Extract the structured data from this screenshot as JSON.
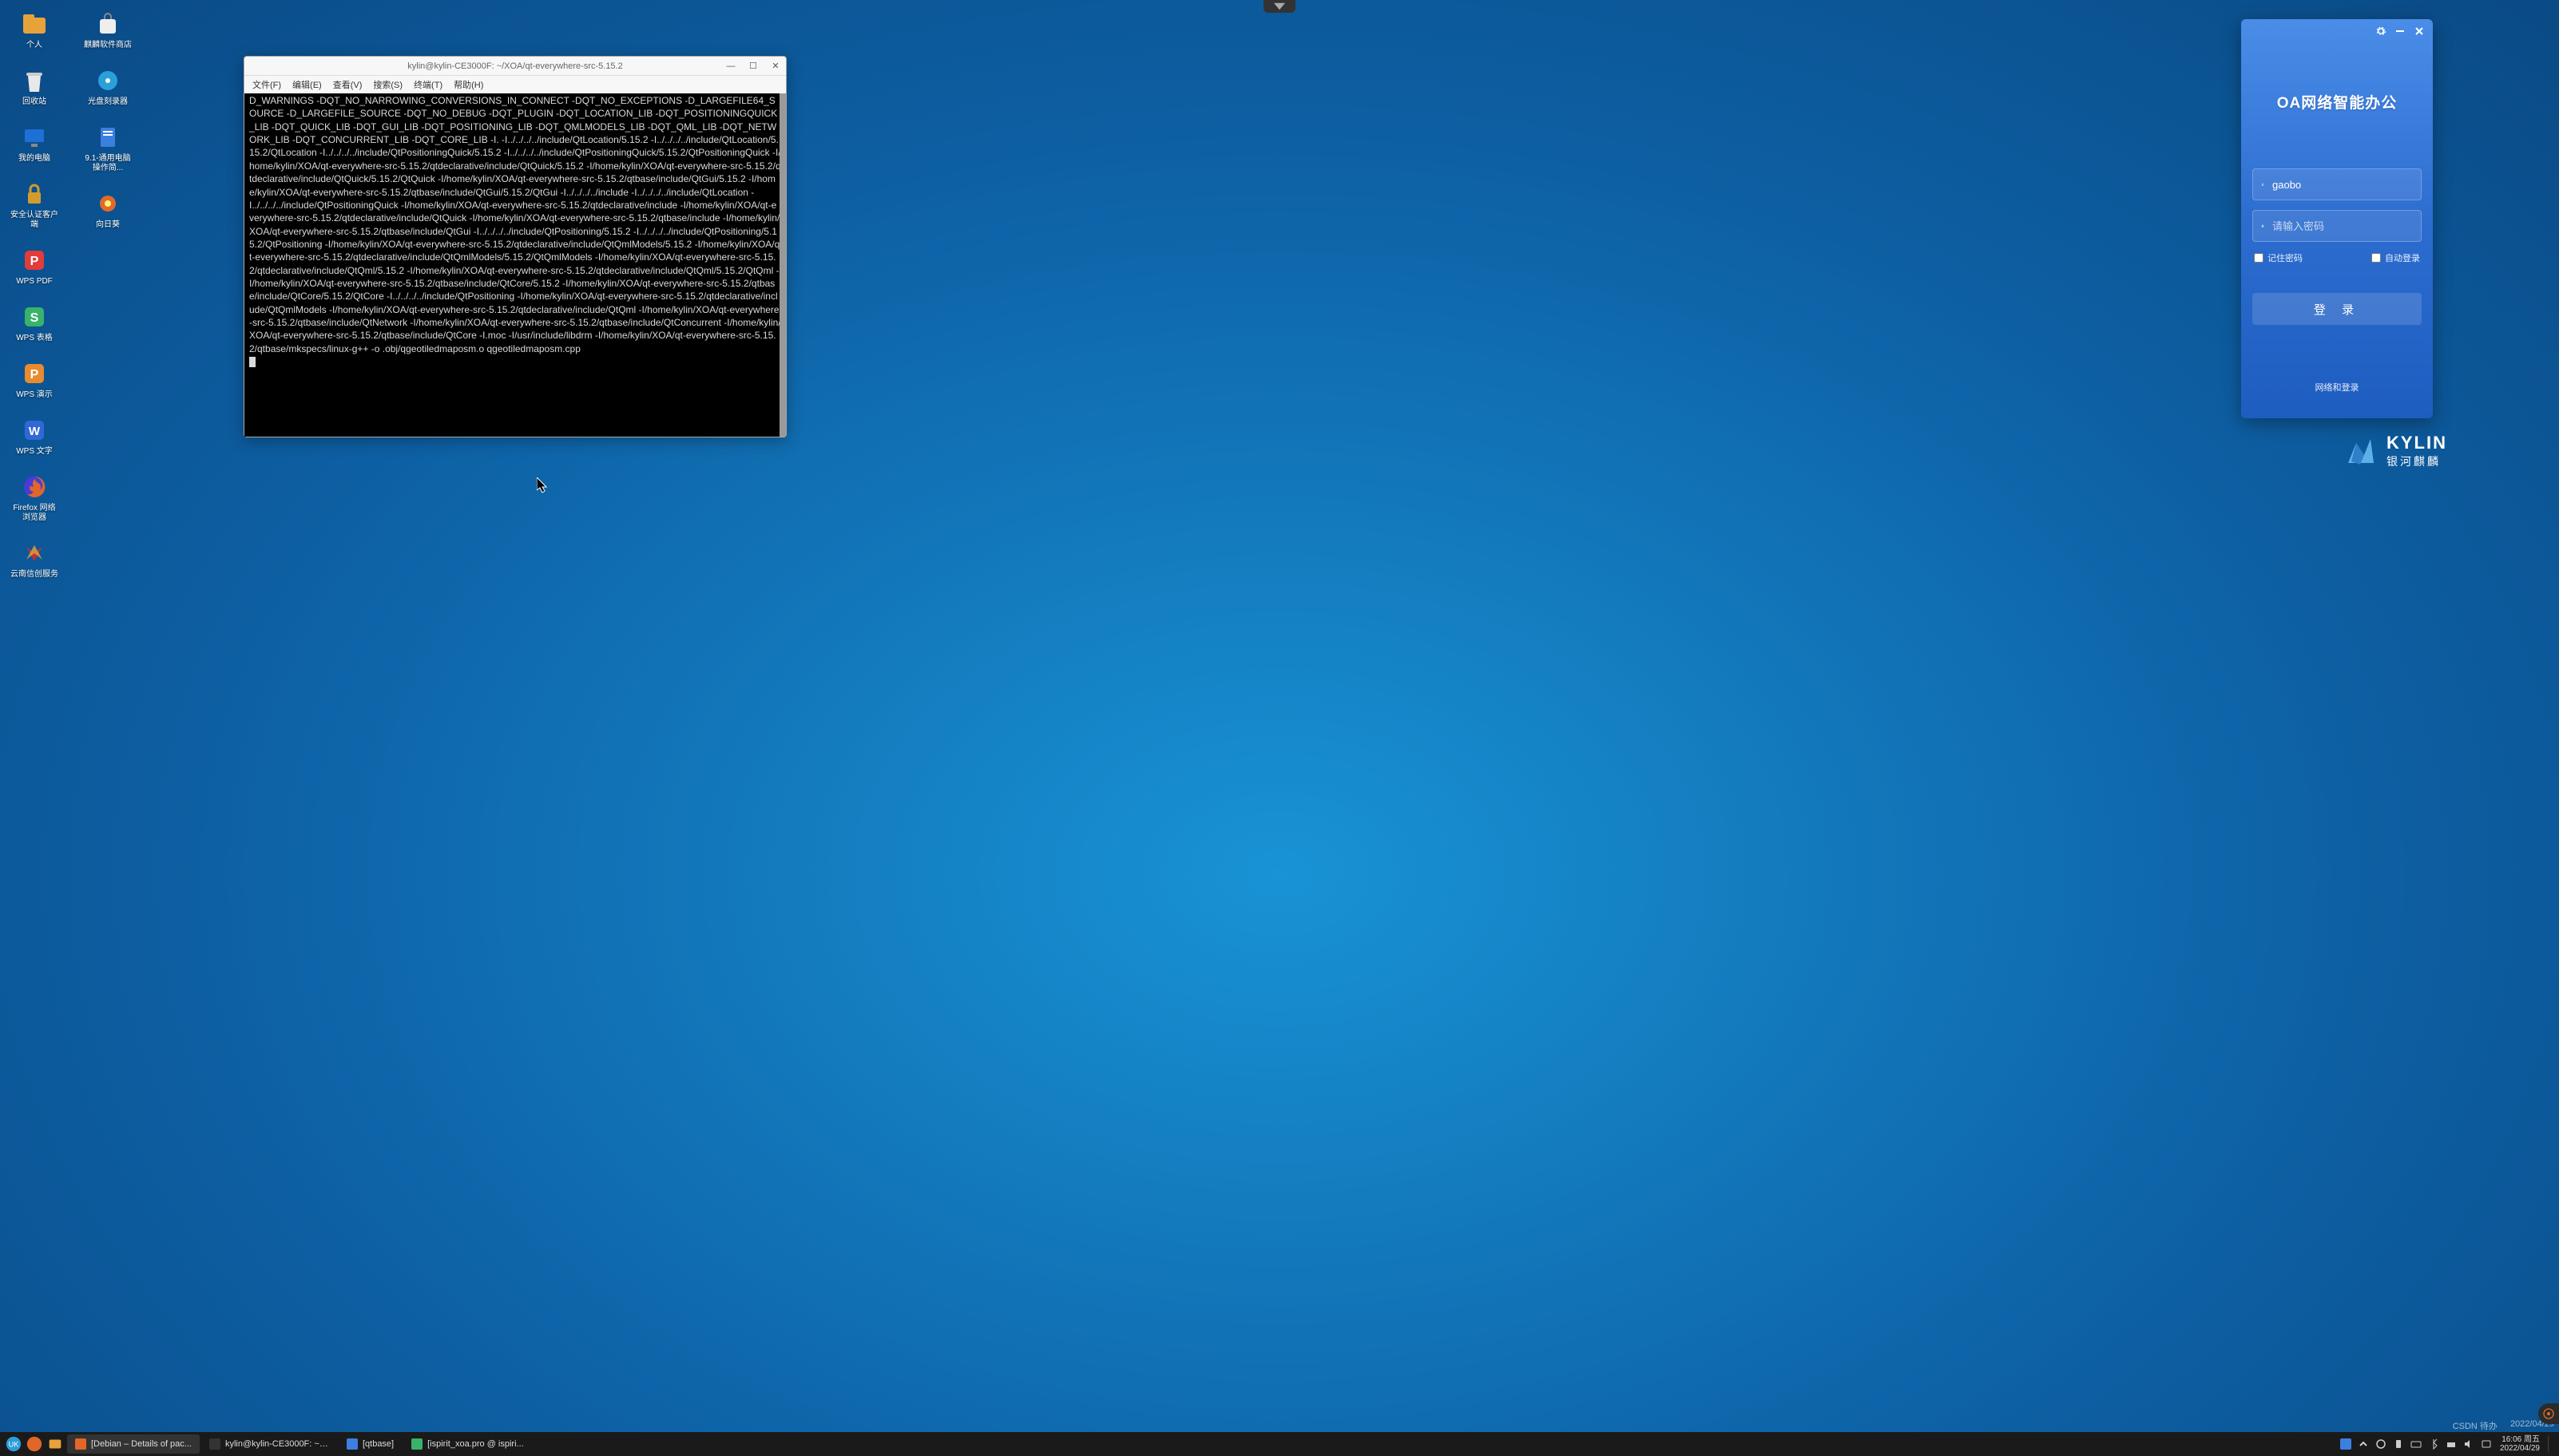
{
  "desktop": {
    "col1": [
      {
        "label": "个人",
        "color": "#e8a23a",
        "icon": "folder"
      },
      {
        "label": "回收站",
        "color": "#e8e8e8",
        "icon": "trash"
      },
      {
        "label": "我的电脑",
        "color": "#1e6fd6",
        "icon": "monitor"
      },
      {
        "label": "安全认证客户端",
        "color": "#d19b2e",
        "icon": "lock"
      },
      {
        "label": "WPS PDF",
        "color": "#e23b3b",
        "icon": "p"
      },
      {
        "label": "WPS 表格",
        "color": "#39b26a",
        "icon": "s"
      },
      {
        "label": "WPS 演示",
        "color": "#e88a2e",
        "icon": "p"
      },
      {
        "label": "WPS 文字",
        "color": "#3068d6",
        "icon": "w"
      },
      {
        "label": "Firefox 网络浏览器",
        "color": "#e0662a",
        "icon": "fire"
      },
      {
        "label": "云南信创服务",
        "color": "#c43030",
        "icon": "x"
      }
    ],
    "col2": [
      {
        "label": "麒麟软件商店",
        "color": "#eee",
        "icon": "bag"
      },
      {
        "label": "光盘刻录器",
        "color": "#2aa0d8",
        "icon": "disc"
      },
      {
        "label": "9.1-通用电脑操作简...",
        "color": "#3b7fe0",
        "icon": "doc"
      },
      {
        "label": "向日葵",
        "color": "#e06a2a",
        "icon": "sun"
      }
    ]
  },
  "terminal": {
    "title": "kylin@kylin-CE3000F: ~/XOA/qt-everywhere-src-5.15.2",
    "menu": [
      "文件(F)",
      "编辑(E)",
      "查看(V)",
      "搜索(S)",
      "终端(T)",
      "帮助(H)"
    ],
    "content": "D_WARNINGS -DQT_NO_NARROWING_CONVERSIONS_IN_CONNECT -DQT_NO_EXCEPTIONS -D_LARGEFILE64_SOURCE -D_LARGEFILE_SOURCE -DQT_NO_DEBUG -DQT_PLUGIN -DQT_LOCATION_LIB -DQT_POSITIONINGQUICK_LIB -DQT_QUICK_LIB -DQT_GUI_LIB -DQT_POSITIONING_LIB -DQT_QMLMODELS_LIB -DQT_QML_LIB -DQT_NETWORK_LIB -DQT_CONCURRENT_LIB -DQT_CORE_LIB -I. -I../../../../include/QtLocation/5.15.2 -I../../../../include/QtLocation/5.15.2/QtLocation -I../../../../include/QtPositioningQuick/5.15.2 -I../../../../include/QtPositioningQuick/5.15.2/QtPositioningQuick -I/home/kylin/XOA/qt-everywhere-src-5.15.2/qtdeclarative/include/QtQuick/5.15.2 -I/home/kylin/XOA/qt-everywhere-src-5.15.2/qtdeclarative/include/QtQuick/5.15.2/QtQuick -I/home/kylin/XOA/qt-everywhere-src-5.15.2/qtbase/include/QtGui/5.15.2 -I/home/kylin/XOA/qt-everywhere-src-5.15.2/qtbase/include/QtGui/5.15.2/QtGui -I../../../../include -I../../../../include/QtLocation -I../../../../include/QtPositioningQuick -I/home/kylin/XOA/qt-everywhere-src-5.15.2/qtdeclarative/include -I/home/kylin/XOA/qt-everywhere-src-5.15.2/qtdeclarative/include/QtQuick -I/home/kylin/XOA/qt-everywhere-src-5.15.2/qtbase/include -I/home/kylin/XOA/qt-everywhere-src-5.15.2/qtbase/include/QtGui -I../../../../include/QtPositioning/5.15.2 -I../../../../include/QtPositioning/5.15.2/QtPositioning -I/home/kylin/XOA/qt-everywhere-src-5.15.2/qtdeclarative/include/QtQmlModels/5.15.2 -I/home/kylin/XOA/qt-everywhere-src-5.15.2/qtdeclarative/include/QtQmlModels/5.15.2/QtQmlModels -I/home/kylin/XOA/qt-everywhere-src-5.15.2/qtdeclarative/include/QtQml/5.15.2 -I/home/kylin/XOA/qt-everywhere-src-5.15.2/qtdeclarative/include/QtQml/5.15.2/QtQml -I/home/kylin/XOA/qt-everywhere-src-5.15.2/qtbase/include/QtCore/5.15.2 -I/home/kylin/XOA/qt-everywhere-src-5.15.2/qtbase/include/QtCore/5.15.2/QtCore -I../../../../include/QtPositioning -I/home/kylin/XOA/qt-everywhere-src-5.15.2/qtdeclarative/include/QtQmlModels -I/home/kylin/XOA/qt-everywhere-src-5.15.2/qtdeclarative/include/QtQml -I/home/kylin/XOA/qt-everywhere-src-5.15.2/qtbase/include/QtNetwork -I/home/kylin/XOA/qt-everywhere-src-5.15.2/qtbase/include/QtConcurrent -I/home/kylin/XOA/qt-everywhere-src-5.15.2/qtbase/include/QtCore -I.moc -I/usr/include/libdrm -I/home/kylin/XOA/qt-everywhere-src-5.15.2/qtbase/mkspecs/linux-g++ -o .obj/qgeotiledmaposm.o qgeotiledmaposm.cpp"
  },
  "oa": {
    "title": "OA网络智能办公",
    "username": "gaobo",
    "password_placeholder": "请输入密码",
    "remember": "记住密码",
    "autologin": "自动登录",
    "submit": "登 录",
    "netlogin": "网络和登录"
  },
  "kylin": {
    "brand": "KYLIN",
    "sub": "银河麒麟"
  },
  "taskbar": {
    "tasks": [
      {
        "label": "[Debian – Details of pac...",
        "icon": "#e0662a"
      },
      {
        "label": "kylin@kylin-CE3000F: ~/...",
        "icon": "#333"
      },
      {
        "label": "[qtbase]",
        "icon": "#3b7fe0"
      },
      {
        "label": "[ispirit_xoa.pro @ ispiri...",
        "icon": "#39b26a"
      }
    ],
    "clock_time": "16:06 周五",
    "clock_date": "2022/04/29"
  },
  "watermark": {
    "left": "CSDN 待办",
    "right": "2022/04/29"
  }
}
